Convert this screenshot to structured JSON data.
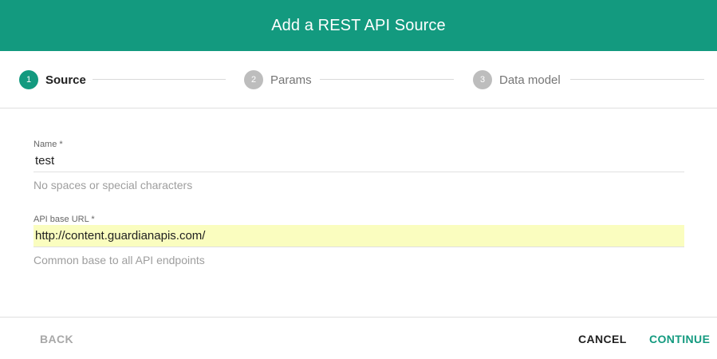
{
  "dialog": {
    "title": "Add a REST API Source"
  },
  "stepper": {
    "steps": [
      {
        "number": "1",
        "label": "Source",
        "active": true
      },
      {
        "number": "2",
        "label": "Params",
        "active": false
      },
      {
        "number": "3",
        "label": "Data model",
        "active": false
      }
    ]
  },
  "form": {
    "name": {
      "label": "Name *",
      "value": "test",
      "help": "No spaces or special characters"
    },
    "base_url": {
      "label": "API base URL *",
      "value": "http://content.guardianapis.com/",
      "help": "Common base to all API endpoints"
    }
  },
  "footer": {
    "back_label": "BACK",
    "cancel_label": "CANCEL",
    "continue_label": "CONTINUE"
  },
  "colors": {
    "accent": "#139a7f",
    "inactive_step": "#bdbdbd",
    "autofill_bg": "#fafdbf"
  }
}
